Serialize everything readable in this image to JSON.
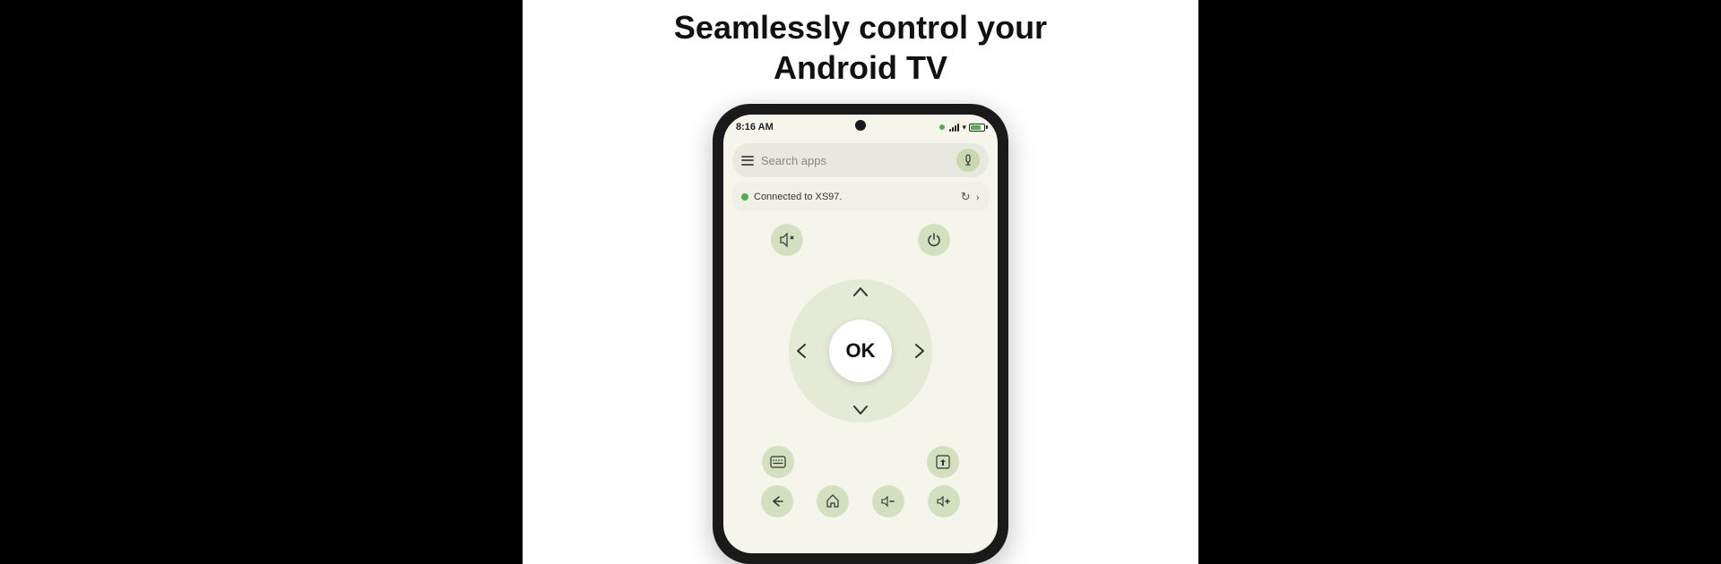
{
  "headline": {
    "line1": "Seamlessly control your",
    "line2": "Android TV"
  },
  "statusBar": {
    "time": "8:16 AM",
    "battery_text": "100"
  },
  "searchBar": {
    "placeholder": "Search apps"
  },
  "connectedBar": {
    "text": "Connected to XS97."
  },
  "dpad": {
    "ok_label": "OK",
    "up_arrow": "∧",
    "down_arrow": "∨",
    "left_arrow": "‹",
    "right_arrow": "›"
  },
  "sideButtons": {
    "mute_icon": "🔇",
    "power_icon": "⏻",
    "keyboard_icon": "⌨",
    "touchpad_icon": "⧉"
  },
  "bottomRow": {
    "back_icon": "↩",
    "home_icon": "⌂",
    "vol_down_icon": "🔉",
    "vol_up_icon": "🔊"
  },
  "colors": {
    "accent_green": "#4caf50",
    "dpad_bg": "#d4dfc0",
    "screen_bg": "#f5f5ec",
    "center_white": "#ffffff"
  }
}
